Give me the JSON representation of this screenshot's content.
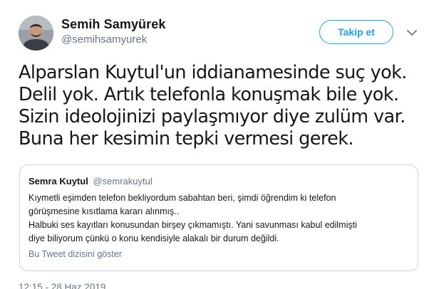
{
  "author": {
    "name": "Semih Samyürek",
    "handle": "@semihsamyurek"
  },
  "follow_button": {
    "label": "Takip et"
  },
  "menu": {
    "icon": "chevron-down-icon"
  },
  "tweet": {
    "lines": [
      "Alparslan Kuytul'un iddianamesinde suç yok.",
      "Delil yok. Artık telefonla konuşmak bile yok.",
      "Sizin ideolojinizi paylaşmıyor diye zulüm var.",
      "Buna her kesimin tepki vermesi gerek."
    ]
  },
  "quoted_tweet": {
    "name": "Semra Kuytul",
    "handle": "@semrakuytul",
    "lines": [
      "Kıymetli eşimden telefon bekliyordum sabahtan beri, şimdi öğrendim ki telefon",
      "görüşmesine kısıtlama kararı alınmış..",
      "Halbuki ses kayıtları konusundan birşey çıkmamıştı. Yani savunması kabul edilmişti",
      "diye biliyorum çünkü o konu kendisiyle alakalı bir durum değildi."
    ],
    "thread_link": "Bu Tweet dizisini göster"
  },
  "timestamp": "12:15 - 28 Haz 2019",
  "colors": {
    "accent": "#1da1f2",
    "text": "#14171a",
    "muted": "#657786",
    "border": "#ccd6dd"
  }
}
